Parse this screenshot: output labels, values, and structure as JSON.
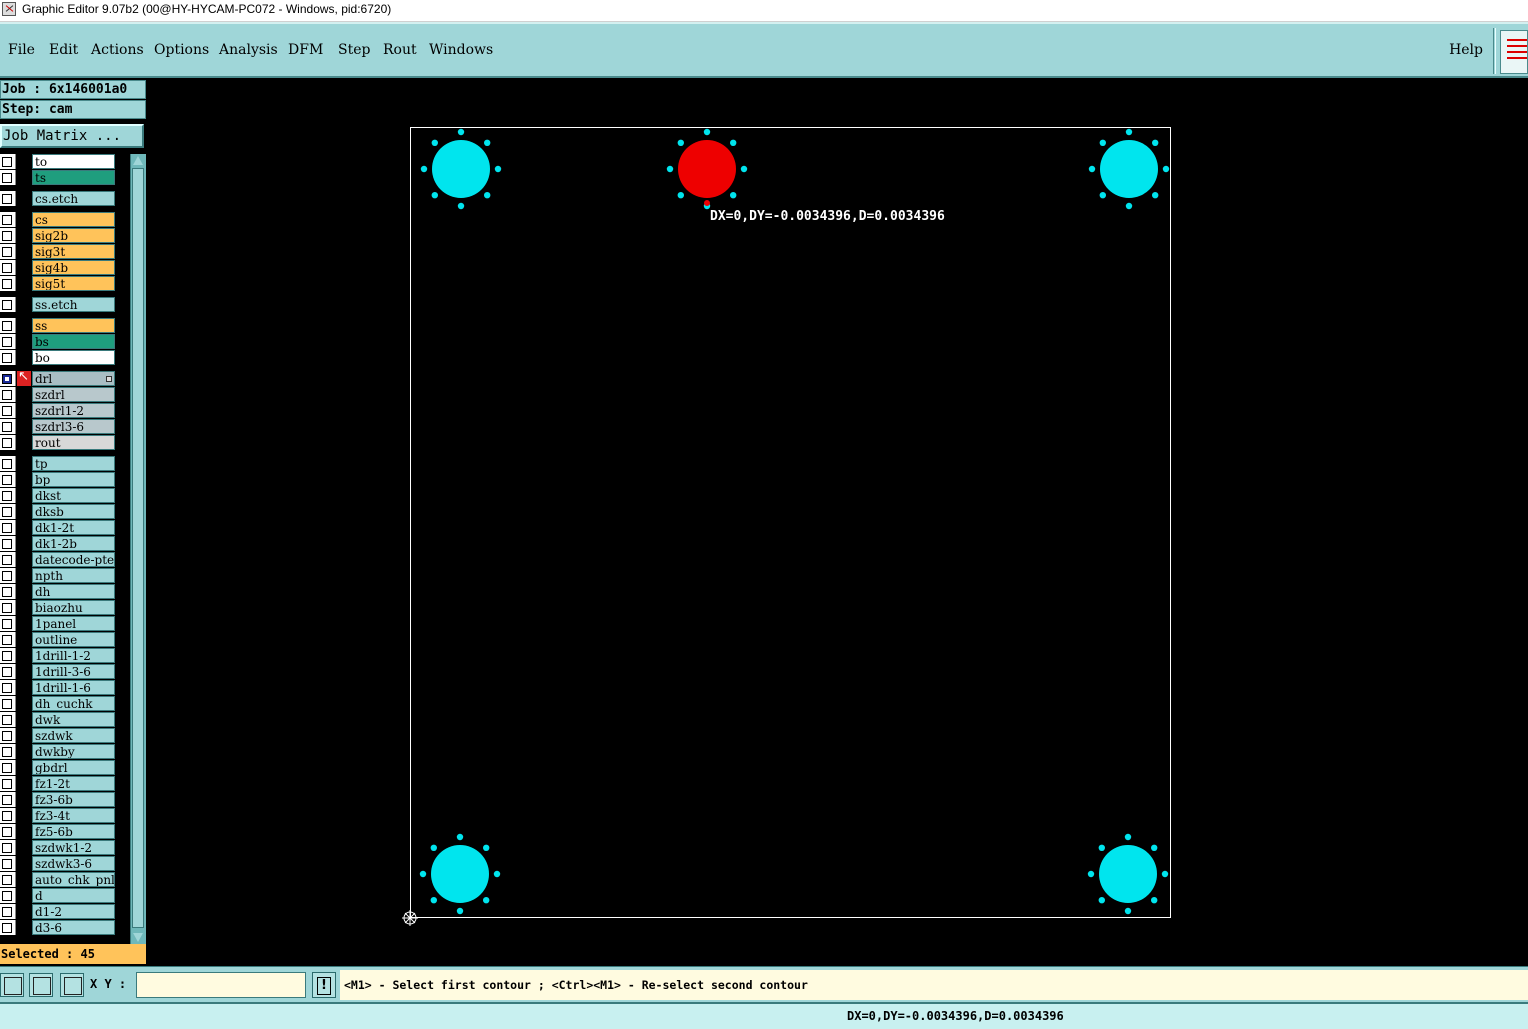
{
  "window": {
    "title": "Graphic Editor 9.07b2 (00@HY-HYCAM-PC072 - Windows, pid:6720)"
  },
  "menu": {
    "items": [
      "File",
      "Edit",
      "Actions",
      "Options",
      "Analysis",
      "DFM",
      "Step",
      "Rout",
      "Windows"
    ],
    "help": "Help"
  },
  "panel": {
    "job": "Job : 6x146001a0",
    "step": "Step: cam",
    "job_matrix": "Job Matrix ...",
    "selected": "Selected : 45"
  },
  "layers": [
    {
      "name": "to",
      "color": "white",
      "group": 0
    },
    {
      "name": "ts",
      "color": "teal",
      "group": 0
    },
    {
      "name": "cs.etch",
      "color": "cyan",
      "group": 1
    },
    {
      "name": "cs",
      "color": "orange",
      "group": 2
    },
    {
      "name": "sig2b",
      "color": "orange",
      "group": 2
    },
    {
      "name": "sig3t",
      "color": "orange",
      "group": 2
    },
    {
      "name": "sig4b",
      "color": "orange",
      "group": 2
    },
    {
      "name": "sig5t",
      "color": "orange",
      "group": 2
    },
    {
      "name": "ss.etch",
      "color": "cyan",
      "group": 3
    },
    {
      "name": "ss",
      "color": "orange",
      "group": 4
    },
    {
      "name": "bs",
      "color": "teal",
      "group": 4
    },
    {
      "name": "bo",
      "color": "white",
      "group": 4
    },
    {
      "name": "drl",
      "color": "drl",
      "group": 5,
      "checked": true,
      "active": true
    },
    {
      "name": "szdrl",
      "color": "grey",
      "group": 5
    },
    {
      "name": "szdrl1-2",
      "color": "grey",
      "group": 5
    },
    {
      "name": "szdrl3-6",
      "color": "grey",
      "group": 5
    },
    {
      "name": "rout",
      "color": "lightgrey",
      "group": 5
    },
    {
      "name": "tp",
      "color": "cyan",
      "group": 6
    },
    {
      "name": "bp",
      "color": "cyan",
      "group": 6
    },
    {
      "name": "dkst",
      "color": "cyan",
      "group": 6
    },
    {
      "name": "dksb",
      "color": "cyan",
      "group": 6
    },
    {
      "name": "dk1-2t",
      "color": "cyan",
      "group": 6
    },
    {
      "name": "dk1-2b",
      "color": "cyan",
      "group": 6
    },
    {
      "name": "datecode-pte",
      "color": "cyan",
      "group": 6
    },
    {
      "name": "npth",
      "color": "cyan",
      "group": 6
    },
    {
      "name": "dh",
      "color": "cyan",
      "group": 6
    },
    {
      "name": "biaozhu",
      "color": "cyan",
      "group": 6
    },
    {
      "name": "1panel",
      "color": "cyan",
      "group": 6
    },
    {
      "name": "outline",
      "color": "cyan",
      "group": 6
    },
    {
      "name": "1drill-1-2",
      "color": "cyan",
      "group": 6
    },
    {
      "name": "1drill-3-6",
      "color": "cyan",
      "group": 6
    },
    {
      "name": "1drill-1-6",
      "color": "cyan",
      "group": 6
    },
    {
      "name": "dh_cuchk",
      "color": "cyan",
      "group": 6
    },
    {
      "name": "dwk",
      "color": "cyan",
      "group": 6
    },
    {
      "name": "szdwk",
      "color": "cyan",
      "group": 6
    },
    {
      "name": "dwkby",
      "color": "cyan",
      "group": 6
    },
    {
      "name": "gbdrl",
      "color": "cyan",
      "group": 6
    },
    {
      "name": "fz1-2t",
      "color": "cyan",
      "group": 6
    },
    {
      "name": "fz3-6b",
      "color": "cyan",
      "group": 6
    },
    {
      "name": "fz3-4t",
      "color": "cyan",
      "group": 6
    },
    {
      "name": "fz5-6b",
      "color": "cyan",
      "group": 6
    },
    {
      "name": "szdwk1-2",
      "color": "cyan",
      "group": 6
    },
    {
      "name": "szdwk3-6",
      "color": "cyan",
      "group": 6
    },
    {
      "name": "auto_chk_pnl",
      "color": "cyan",
      "group": 6
    },
    {
      "name": "d",
      "color": "cyan",
      "group": 6
    },
    {
      "name": "d1-2",
      "color": "cyan",
      "group": 6
    },
    {
      "name": "d3-6",
      "color": "cyan",
      "group": 6
    }
  ],
  "canvas": {
    "measure_label": "DX=0,DY=-0.0034396,D=0.0034396",
    "colors": {
      "pad": "#00e5ee",
      "selected_pad": "#ee0000",
      "outline": "#ffffff"
    }
  },
  "command": {
    "xy_label": "X Y :",
    "xy_value": "",
    "warn_icon": "!",
    "prompt": "<M1> - Select first contour ; <Ctrl><M1> - Re-select second contour"
  },
  "status": {
    "text": "DX=0,DY=-0.0034396,D=0.0034396"
  }
}
